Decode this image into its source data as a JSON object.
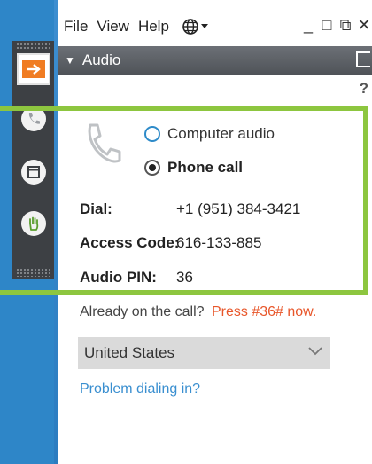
{
  "menu": {
    "file": "File",
    "view": "View",
    "help": "Help",
    "language_icon": "globe-icon"
  },
  "window_controls": {
    "minimize": "_",
    "maximize": "□",
    "restore": "⧉",
    "close": "✕"
  },
  "audio_panel": {
    "title": "Audio",
    "help": "?"
  },
  "toolbar": {
    "items": [
      {
        "name": "arrow-right-icon"
      },
      {
        "name": "phone-icon"
      },
      {
        "name": "window-icon"
      },
      {
        "name": "hand-icon"
      }
    ],
    "accent": "#f07c22"
  },
  "audio_options": {
    "computer_audio": "Computer audio",
    "phone_call": "Phone call",
    "selected": "phone_call"
  },
  "dial_info": {
    "dial_label": "Dial:",
    "dial_value": "+1 (951) 384-3421",
    "access_code_label": "Access Code:",
    "access_code_value": "616-133-885",
    "audio_pin_label": "Audio PIN:",
    "audio_pin_value": "36"
  },
  "already_on_call": {
    "text": "Already on the call?",
    "instruction": "Press #36# now."
  },
  "country_select": {
    "value": "United States"
  },
  "problem_link": "Problem dialing in?",
  "colors": {
    "highlight_green": "#8dc63f",
    "link_blue": "#3a8fd0",
    "press_orange": "#e8562a",
    "background_blue": "#2e86c8"
  }
}
